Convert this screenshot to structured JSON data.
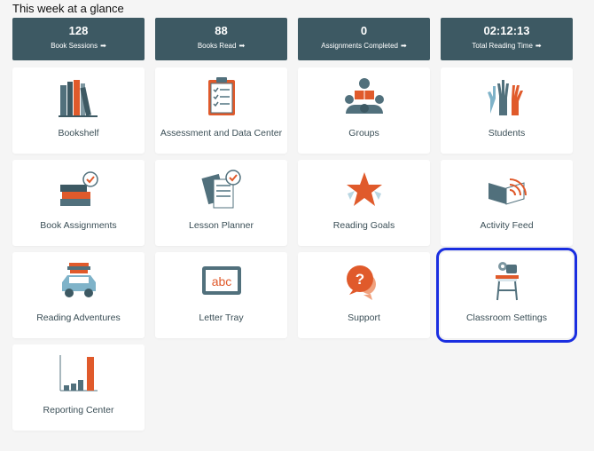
{
  "heading": "This week at a glance",
  "stats": [
    {
      "value": "128",
      "label": "Book Sessions"
    },
    {
      "value": "88",
      "label": "Books Read"
    },
    {
      "value": "0",
      "label": "Assignments Completed"
    },
    {
      "value": "02:12:13",
      "label": "Total Reading Time"
    }
  ],
  "tiles": [
    {
      "label": "Bookshelf",
      "icon": "bookshelf-icon"
    },
    {
      "label": "Assessment and Data Center",
      "icon": "clipboard-checklist-icon"
    },
    {
      "label": "Groups",
      "icon": "reading-group-icon"
    },
    {
      "label": "Students",
      "icon": "raised-hands-icon"
    },
    {
      "label": "Book Assignments",
      "icon": "book-stack-check-icon"
    },
    {
      "label": "Lesson Planner",
      "icon": "lesson-plan-icon"
    },
    {
      "label": "Reading Goals",
      "icon": "star-icon"
    },
    {
      "label": "Activity Feed",
      "icon": "activity-feed-icon"
    },
    {
      "label": "Reading Adventures",
      "icon": "car-books-icon"
    },
    {
      "label": "Letter Tray",
      "icon": "abc-board-icon"
    },
    {
      "label": "Support",
      "icon": "question-chat-icon"
    },
    {
      "label": "Classroom Settings",
      "icon": "desk-gear-icon"
    },
    {
      "label": "Reporting Center",
      "icon": "bar-chart-icon"
    }
  ],
  "selected_tile": "Classroom Settings",
  "colors": {
    "stat_bg": "#3d5963",
    "accent_orange": "#e05a2b",
    "icon_slate": "#51707c",
    "selection_outline": "#1a2ee0"
  }
}
